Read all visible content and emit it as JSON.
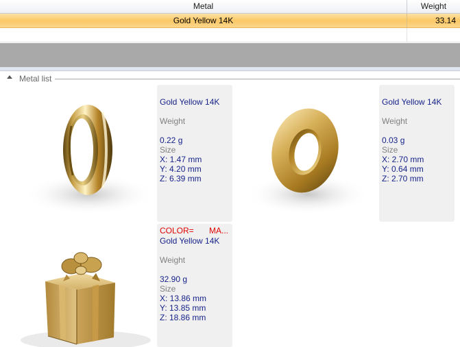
{
  "grid": {
    "columns": {
      "metal": "Metal",
      "weight": "Weight"
    },
    "selected_row": {
      "metal": "Gold Yellow 14K",
      "weight": "33.14"
    }
  },
  "group": {
    "title": "Metal list"
  },
  "items": [
    {
      "metal": "Gold Yellow 14K",
      "weight_label": "Weight",
      "weight": "0.22 g",
      "size_label": "Size",
      "x": "X: 1.47 mm",
      "y": "Y: 4.20 mm",
      "z": "Z: 6.39 mm",
      "icon": "ring-icon"
    },
    {
      "metal": "Gold Yellow 14K",
      "weight_label": "Weight",
      "weight": "0.03 g",
      "size_label": "Size",
      "x": "X: 2.70 mm",
      "y": "Y: 0.64 mm",
      "z": "Z: 2.70 mm",
      "icon": "donut-ring-icon"
    },
    {
      "color_label": "COLOR=",
      "color_value": "MA...",
      "metal": "Gold Yellow 14K",
      "weight_label": "Weight",
      "weight": "32.90 g",
      "size_label": "Size",
      "x": "X: 13.86 mm",
      "y": "Y: 13.85 mm",
      "z": "Z: 18.86 mm",
      "icon": "gift-box-icon"
    }
  ],
  "colors": {
    "selection_top": "#fde2a6",
    "selection_mid": "#fbc866",
    "info_text": "#17238a",
    "label_text": "#808080",
    "alert_text": "#e00000",
    "card_bg": "#f0f0f0",
    "band": "#a9a9a9"
  }
}
